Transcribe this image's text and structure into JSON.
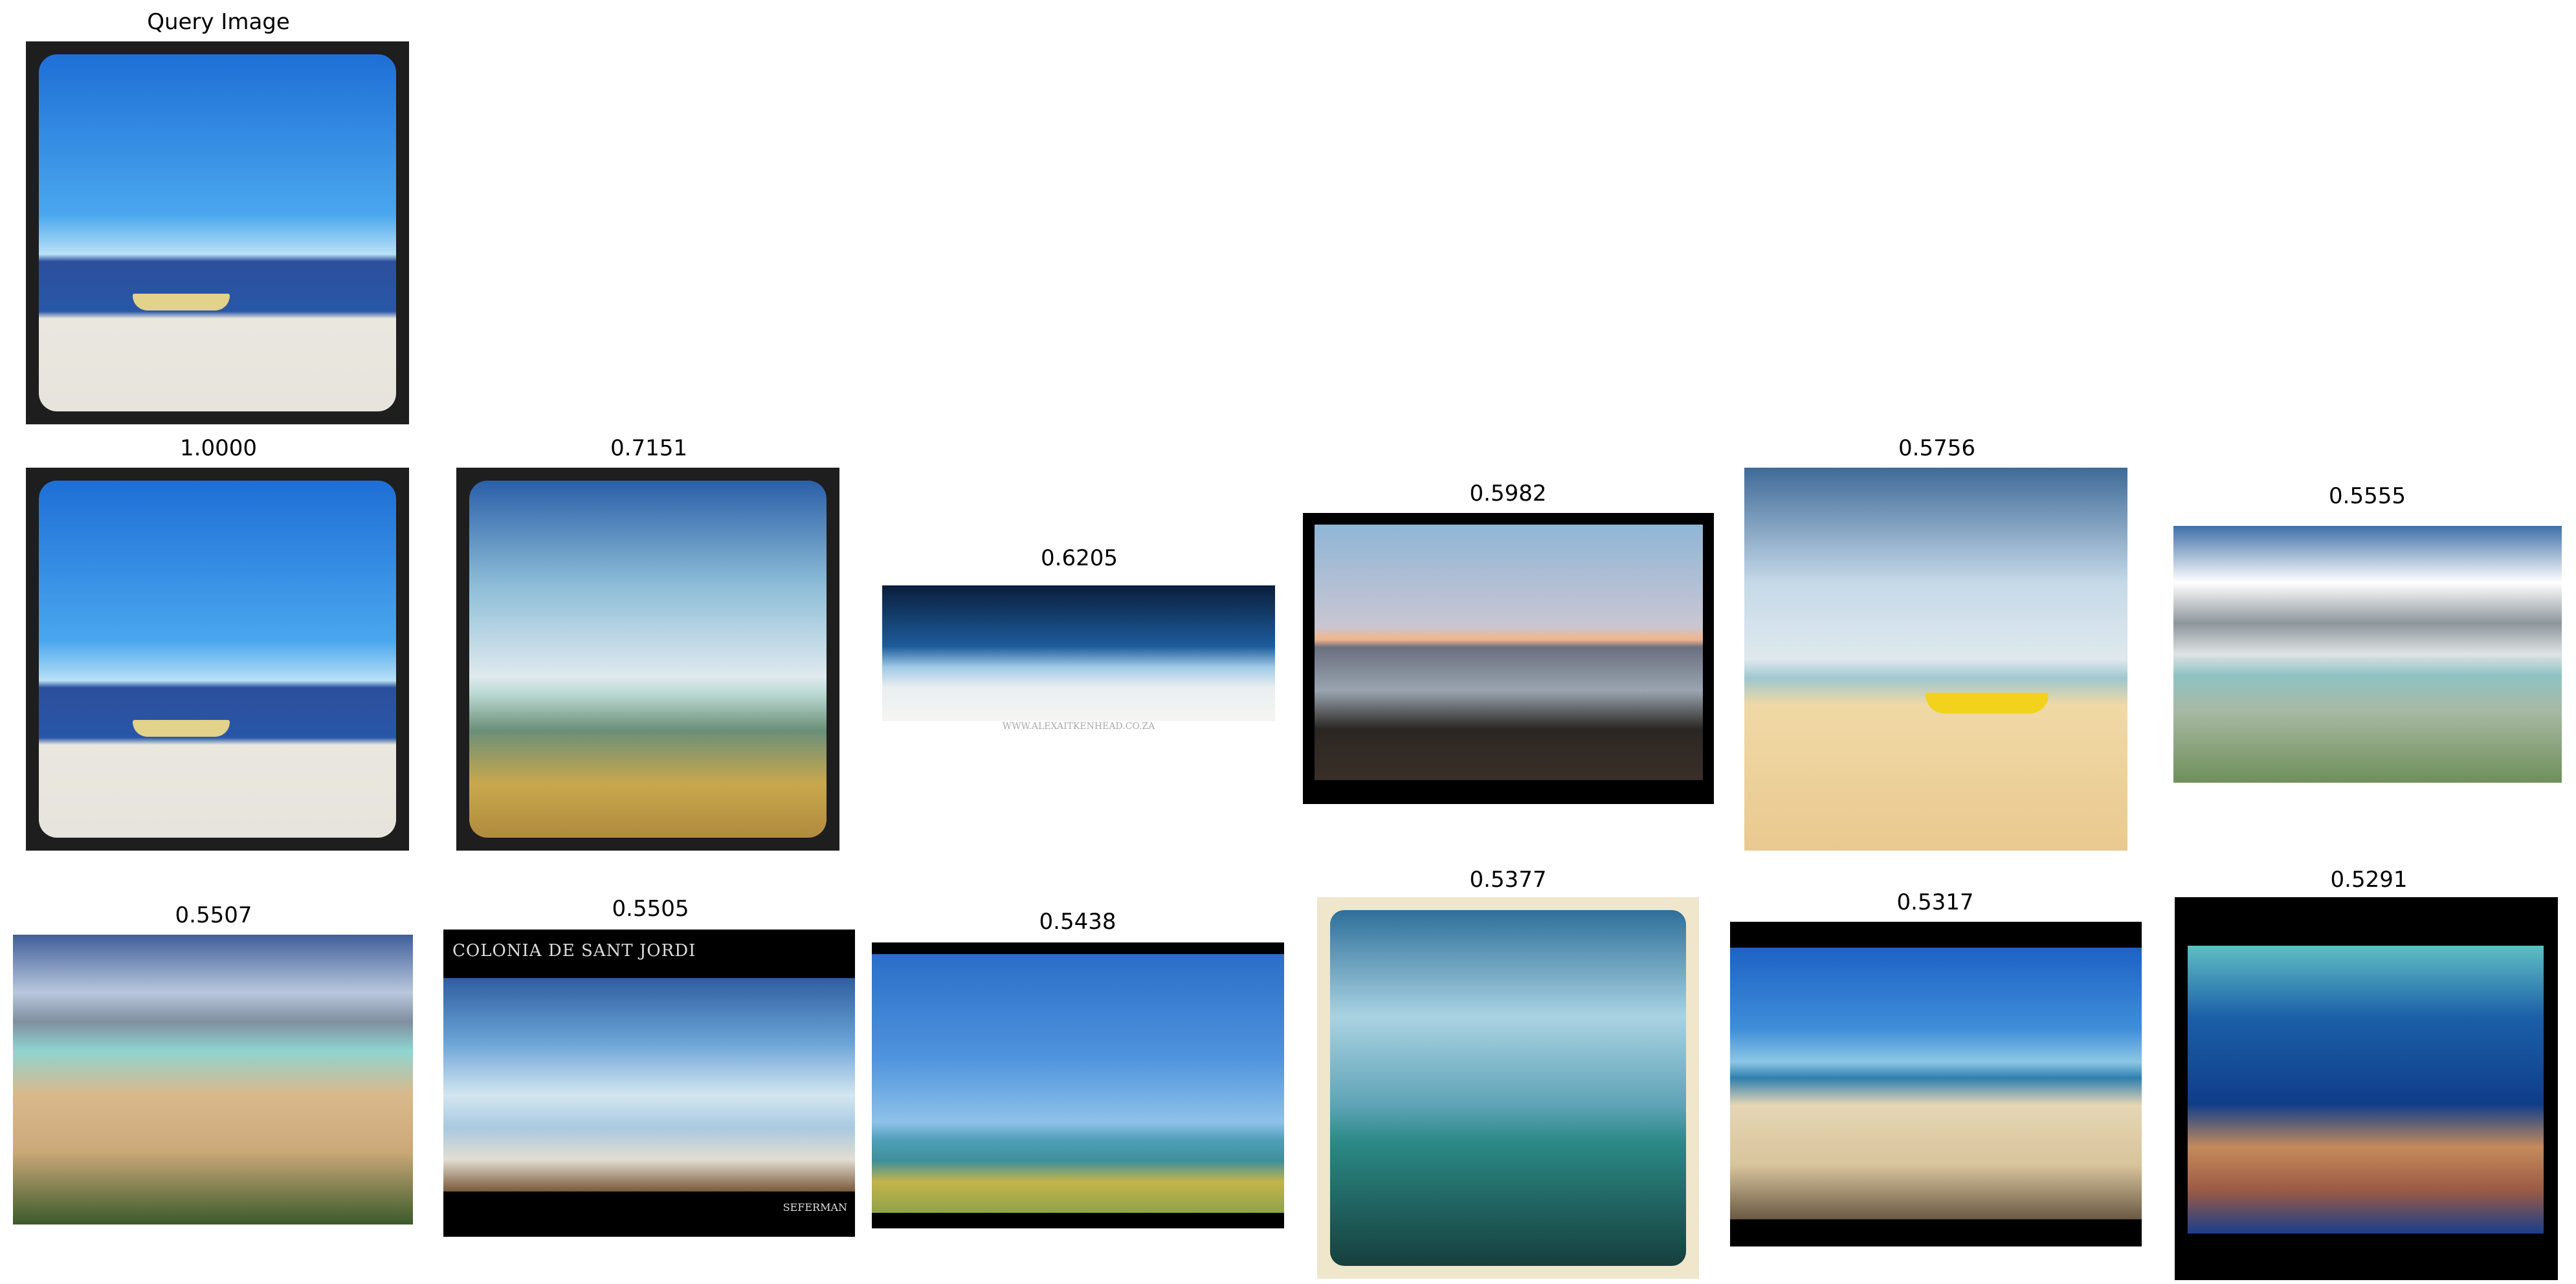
{
  "query": {
    "label": "Query Image"
  },
  "results": [
    {
      "score": "1.0000"
    },
    {
      "score": "0.7151"
    },
    {
      "score": "0.6205"
    },
    {
      "score": "0.5982"
    },
    {
      "score": "0.5756"
    },
    {
      "score": "0.5555"
    },
    {
      "score": "0.5507"
    },
    {
      "score": "0.5505",
      "overlay_title": "COLONIA DE SANT JORDI",
      "overlay_signature": "SEFERMAN"
    },
    {
      "score": "0.5438"
    },
    {
      "score": "0.5377"
    },
    {
      "score": "0.5317"
    },
    {
      "score": "0.5291"
    }
  ],
  "watermarks": {
    "r2_url": "WWW.ALEXAITKENHEAD.CO.ZA"
  },
  "colors": {
    "background": "#ffffff",
    "frame_dark": "#1e1e1e",
    "sky_blue": "#2e8fe0",
    "sand": "#e8e2d4"
  }
}
